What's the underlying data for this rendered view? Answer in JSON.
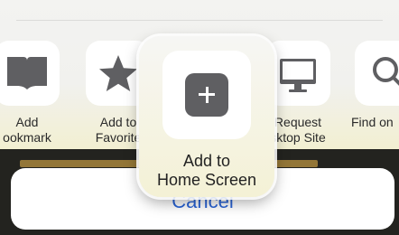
{
  "actions": [
    {
      "label": "Add\nookmark",
      "icon": "book-icon"
    },
    {
      "label": "Add to\nFavorite",
      "icon": "star-icon"
    },
    {
      "label": "Add to\nHome Screen",
      "icon": "add-square-icon"
    },
    {
      "label": "Request\nsktop Site",
      "icon": "monitor-icon"
    },
    {
      "label": "Find on",
      "icon": "search-icon"
    }
  ],
  "cancel_label": "Cancel"
}
